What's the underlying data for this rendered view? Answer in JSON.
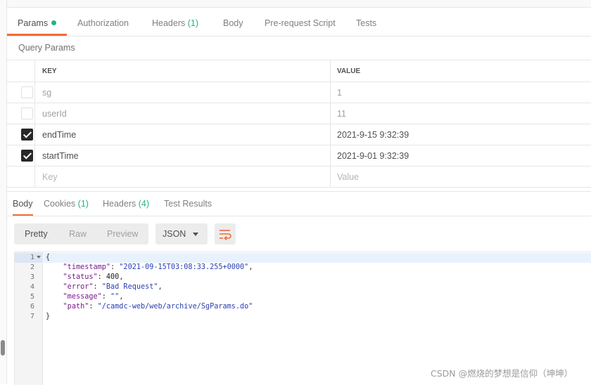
{
  "request_tabs": {
    "params": "Params",
    "authorization": "Authorization",
    "headers": "Headers",
    "headers_count": "(1)",
    "body": "Body",
    "prerequest": "Pre-request Script",
    "tests": "Tests"
  },
  "query_params": {
    "title": "Query Params",
    "col_key": "KEY",
    "col_value": "VALUE",
    "rows": [
      {
        "checked": false,
        "key": "sg",
        "value": "1"
      },
      {
        "checked": false,
        "key": "userId",
        "value": "11"
      },
      {
        "checked": true,
        "key": "endTime",
        "value": "2021-9-15 9:32:39"
      },
      {
        "checked": true,
        "key": "startTime",
        "value": "2021-9-01 9:32:39"
      }
    ],
    "placeholder_key": "Key",
    "placeholder_value": "Value"
  },
  "response_tabs": {
    "body": "Body",
    "cookies": "Cookies",
    "cookies_count": "(1)",
    "headers": "Headers",
    "headers_count": "(4)",
    "test_results": "Test Results"
  },
  "format": {
    "pretty": "Pretty",
    "raw": "Raw",
    "preview": "Preview",
    "language": "JSON",
    "wrap_icon": "wrap-lines-icon"
  },
  "response_body": {
    "line_numbers": [
      "1",
      "2",
      "3",
      "4",
      "5",
      "6",
      "7"
    ],
    "timestamp_key": "\"timestamp\"",
    "timestamp_val": "\"2021-09-15T03:08:33.255+0000\"",
    "status_key": "\"status\"",
    "status_val": "400",
    "error_key": "\"error\"",
    "error_val": "\"Bad Request\"",
    "message_key": "\"message\"",
    "message_val": "\"\"",
    "path_key": "\"path\"",
    "path_val": "\"/camdc-web/web/archive/SgParams.do\""
  },
  "watermark": "CSDN @燃烧的梦想是信仰（坤坤）",
  "colors": {
    "accent": "#f26b3a",
    "green": "#26b47f"
  }
}
